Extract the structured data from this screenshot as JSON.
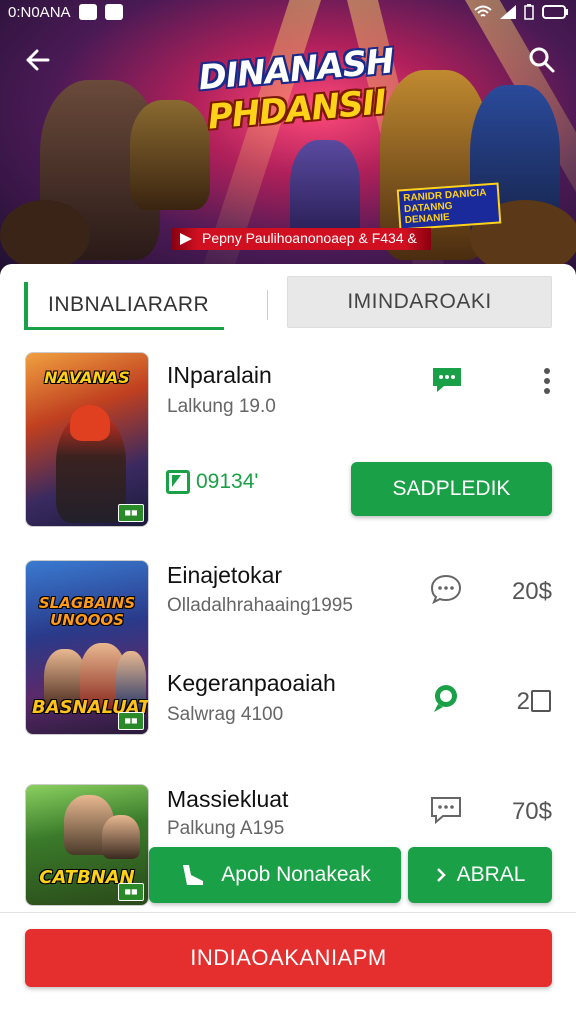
{
  "status_bar": {
    "time": "0:N0ANA"
  },
  "banner": {
    "title_line1": "DINANASH",
    "title_line2": "PHDANSII",
    "tag_text": "RANIDR DANICIA DATANNG DENANIE",
    "strip_text": "Pepny Paulihoanonoaep & F434 &"
  },
  "tabs": [
    {
      "label": "INBNALIARARR",
      "active": true
    },
    {
      "label": "IMINDAROAKI",
      "active": false
    }
  ],
  "games": [
    {
      "thumb_title": "NAVANAS",
      "title": "INparalain",
      "subtitle": "Lalkung 19.0",
      "rating": "09134ʹ",
      "action_label": "SADPLEDIK"
    },
    {
      "thumb_title": "SLAGBAINS UNOOOS",
      "thumb_title2": "BASNALUAT",
      "title": "Einajetokar",
      "subtitle": "Olladalhrahaaing1995",
      "price": "20$"
    },
    {
      "title": "Kegeranpaoaiah",
      "subtitle": "Salwrag 4100",
      "price": "2"
    },
    {
      "thumb_title": "CATBNAN",
      "title": "Massiekluat",
      "subtitle": "Palkung A195",
      "price": "70$"
    }
  ],
  "buttons": {
    "app_download": "Apob Nonakeak",
    "abral": "ABRAL",
    "main_cta": "INDIAOAKANIAPM"
  },
  "colors": {
    "accent_green": "#1aa047",
    "cta_red": "#e52e2e"
  },
  "icons": [
    "back-arrow-icon",
    "search-icon",
    "chat-icon",
    "more-vert-icon",
    "rating-icon",
    "chevron-right-icon",
    "notification-icon",
    "wifi-icon",
    "signal-icon",
    "battery-icon"
  ]
}
